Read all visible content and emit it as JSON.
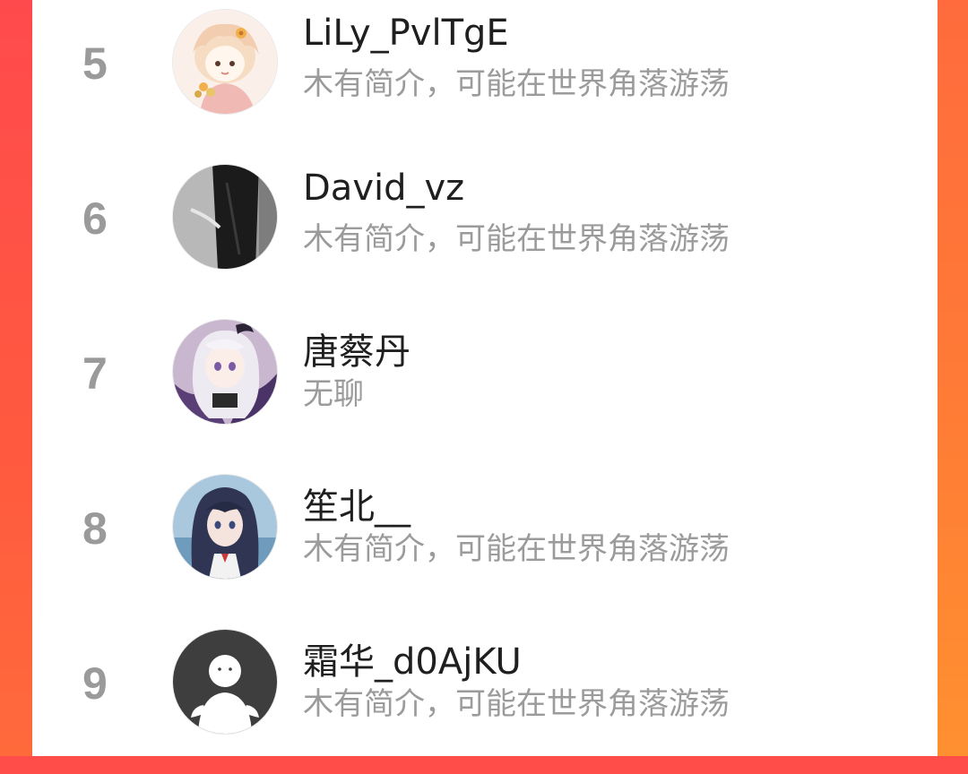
{
  "ranking": {
    "items": [
      {
        "rank": "5",
        "name": "LiLy_PvlTgE",
        "bio": "木有简介，可能在世界角落游荡",
        "avatar_icon": "anime-girl-flower-avatar-icon"
      },
      {
        "rank": "6",
        "name": "David_vz",
        "bio": "木有简介，可能在世界角落游荡",
        "avatar_icon": "dark-figure-avatar-icon"
      },
      {
        "rank": "7",
        "name": "唐蔡丹",
        "bio": "无聊",
        "avatar_icon": "silver-hair-anime-avatar-icon"
      },
      {
        "rank": "8",
        "name": "笙北__",
        "bio": "木有简介，可能在世界角落游荡",
        "avatar_icon": "dark-hair-anime-avatar-icon"
      },
      {
        "rank": "9",
        "name": "霜华_d0AjKU",
        "bio": "木有简介，可能在世界角落游荡",
        "avatar_icon": "default-user-avatar-icon"
      }
    ]
  },
  "colors": {
    "rank_text": "#9a9a9a",
    "name_text": "#1f1f1f",
    "bio_text": "#9b9b9b",
    "background_accent": "#ff5a3f"
  }
}
